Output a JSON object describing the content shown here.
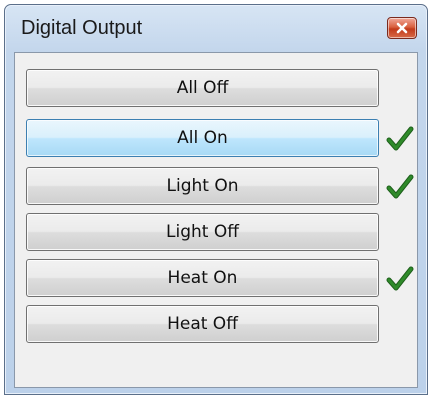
{
  "window": {
    "title": "Digital Output",
    "close_icon": "close-icon"
  },
  "buttons": [
    {
      "label": "All Off",
      "checked": false,
      "focused": false
    },
    {
      "label": "All On",
      "checked": true,
      "focused": true
    },
    {
      "label": "Light On",
      "checked": true,
      "focused": false
    },
    {
      "label": "Light Off",
      "checked": false,
      "focused": false
    },
    {
      "label": "Heat On",
      "checked": true,
      "focused": false
    },
    {
      "label": "Heat Off",
      "checked": false,
      "focused": false
    }
  ],
  "check_icon": "checkmark-icon",
  "colors": {
    "check": "#2f8a2a",
    "focus_border": "#3c7fb1",
    "close": "#c23a1a"
  }
}
